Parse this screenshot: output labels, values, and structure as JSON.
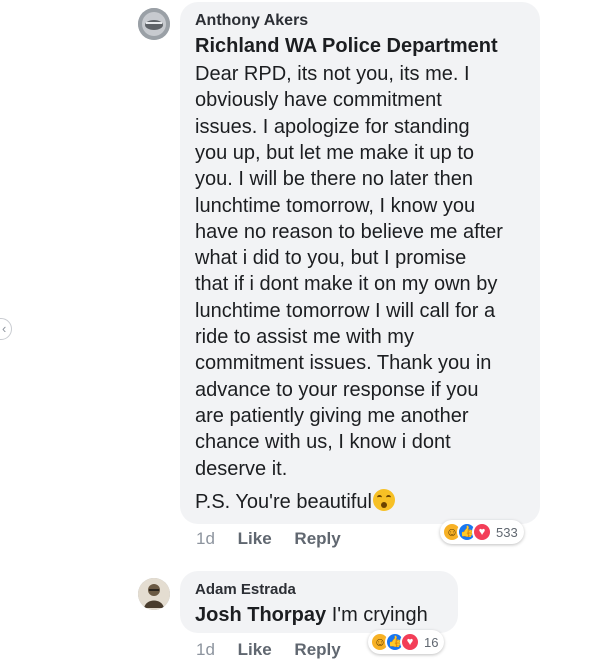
{
  "comments": [
    {
      "author": "Anthony Akers",
      "tagged": "Richland WA Police Department",
      "body_lines": [
        "Dear RPD, its not you, its me. I",
        "obviously have commitment",
        "issues. I apologize for standing",
        "you up, but let me make it up to",
        "you. I will be there no later then",
        "lunchtime tomorrow, I know you",
        "have no reason to believe me after",
        "what i did to you, but I promise",
        "that if i dont make it on my own by",
        "lunchtime tomorrow I will call for a",
        "ride to assist me with my",
        "commitment issues. Thank you in",
        "advance to your response if you",
        "are patiently giving me another",
        "chance with us, I know i dont",
        "deserve it."
      ],
      "ps": "P.S. You're beautiful",
      "ps_emoji": "kissing-face-emoji",
      "time": "1d",
      "like_label": "Like",
      "reply_label": "Reply",
      "reaction_count": "533",
      "reactions": [
        "haha",
        "like",
        "love"
      ]
    },
    {
      "author": "Adam Estrada",
      "tagged": "Josh Thorpay",
      "text": " I'm cryingh",
      "time": "1d",
      "like_label": "Like",
      "reply_label": "Reply",
      "reaction_count": "16",
      "reactions": [
        "haha",
        "like",
        "love"
      ]
    }
  ],
  "icons": {
    "reaction_haha": "laughing-face",
    "reaction_like": "thumbs-up",
    "reaction_love": "heart"
  },
  "colors": {
    "bubble": "#f2f3f5",
    "like_blue": "#1877f2",
    "love_red": "#f33e58",
    "haha_yellow": "#f7b125",
    "action_gray": "#606770"
  }
}
